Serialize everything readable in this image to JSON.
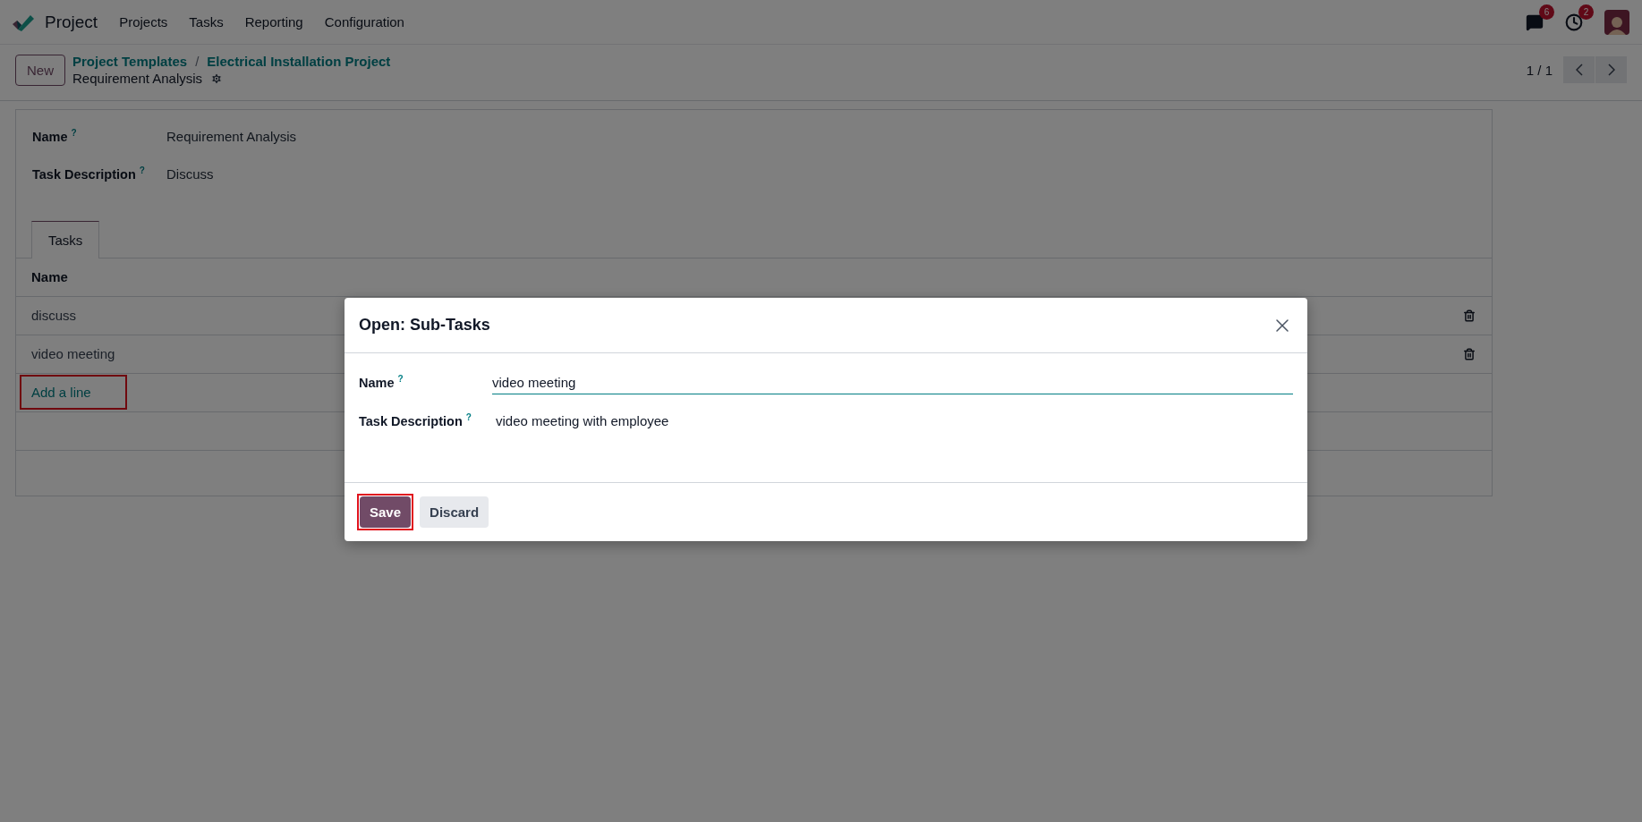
{
  "navbar": {
    "app_name": "Project",
    "menu": [
      "Projects",
      "Tasks",
      "Reporting",
      "Configuration"
    ],
    "messages_badge": "6",
    "activities_badge": "2"
  },
  "control_panel": {
    "new_button": "New",
    "breadcrumbs": [
      "Project Templates",
      "Electrical Installation Project"
    ],
    "separator": "/",
    "record_title": "Requirement Analysis",
    "pager": "1 / 1"
  },
  "form": {
    "fields": [
      {
        "label": "Name",
        "help": "?",
        "value": "Requirement Analysis"
      },
      {
        "label": "Task Description",
        "help": "?",
        "value": "Discuss"
      }
    ],
    "tabs": [
      {
        "label": "Tasks",
        "selected": true
      }
    ],
    "table": {
      "columns": [
        "Name"
      ],
      "rows": [
        {
          "name": "discuss"
        },
        {
          "name": "video meeting"
        }
      ],
      "add_line": "Add a line",
      "add_line_highlighted": true
    }
  },
  "dialog": {
    "title": "Open: Sub-Tasks",
    "fields": [
      {
        "label": "Name",
        "help": "?",
        "value": "video meeting",
        "kind": "input"
      },
      {
        "label": "Task Description",
        "help": "?",
        "value": "video meeting with employee",
        "kind": "html"
      }
    ],
    "buttons": [
      {
        "label": "Save",
        "kind": "primary",
        "highlighted": true
      },
      {
        "label": "Discard",
        "kind": "secondary",
        "highlighted": false
      }
    ]
  }
}
